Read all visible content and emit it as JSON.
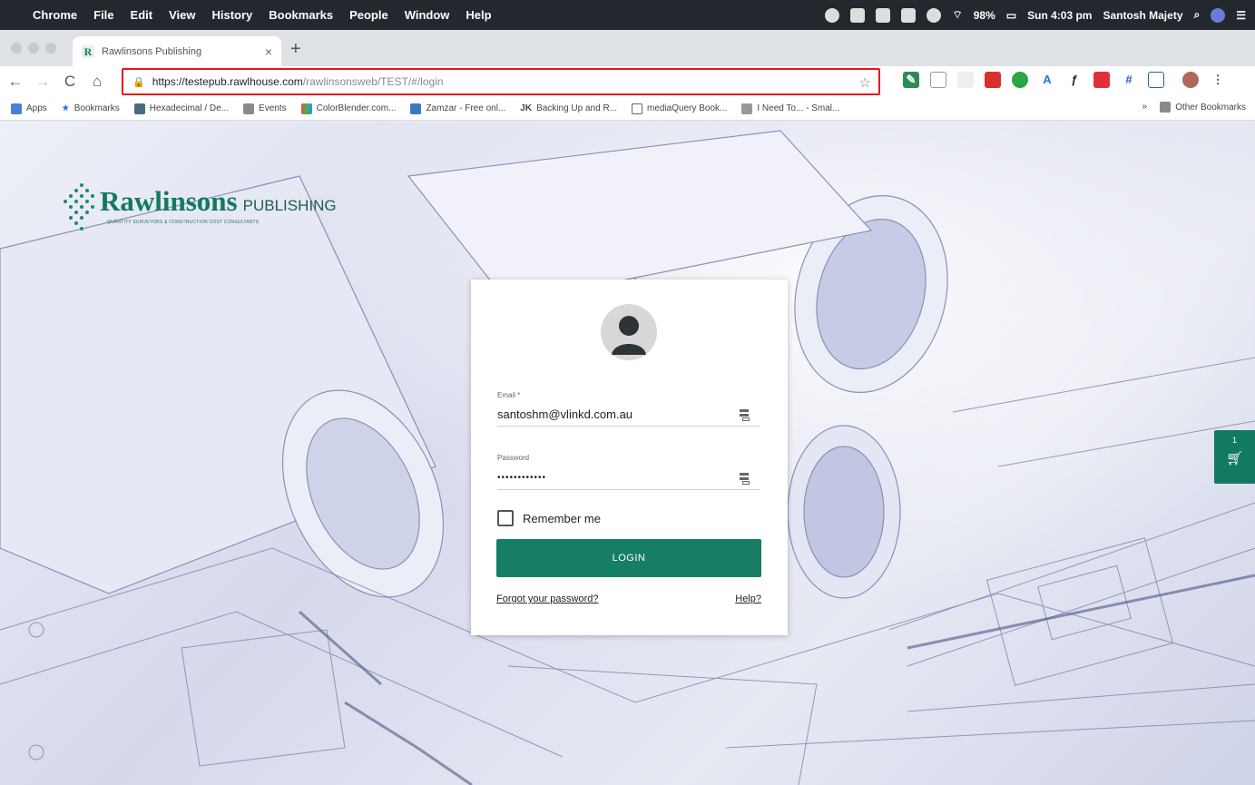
{
  "menubar": {
    "app": "Chrome",
    "items": [
      "File",
      "Edit",
      "View",
      "History",
      "Bookmarks",
      "People",
      "Window",
      "Help"
    ],
    "battery": "98%",
    "clock": "Sun 4:03 pm",
    "user": "Santosh Majety"
  },
  "browser": {
    "tab_title": "Rawlinsons Publishing",
    "favicon_letter": "R",
    "url_host": "https://testepub.rawlhouse.com",
    "url_path": "/rawlinsonsweb/TEST/#/login",
    "bookmarks": [
      "Apps",
      "Bookmarks",
      "Hexadecimal / De...",
      "Events",
      "ColorBlender.com...",
      "Zamzar - Free onl...",
      "Backing Up and R...",
      "mediaQuery Book...",
      "I Need To... - Smal..."
    ],
    "bookmarks_overflow": "»",
    "other_bookmarks": "Other Bookmarks"
  },
  "logo": {
    "name": "Rawlinsons",
    "suffix": "PUBLISHING",
    "tagline": "QUANTITY SURVEYORS & CONSTRUCTION COST CONSULTANTS"
  },
  "login": {
    "email_label": "Email *",
    "email_value": "santoshm@vlinkd.com.au",
    "password_label": "Password",
    "password_value": "••••••••••••",
    "remember_label": "Remember me",
    "login_button": "LOGIN",
    "forgot_link": "Forgot your password?",
    "help_link": "Help?"
  },
  "cart": {
    "count": "1"
  },
  "colors": {
    "brand_green": "#177e66",
    "highlight_red": "#e8141a"
  }
}
